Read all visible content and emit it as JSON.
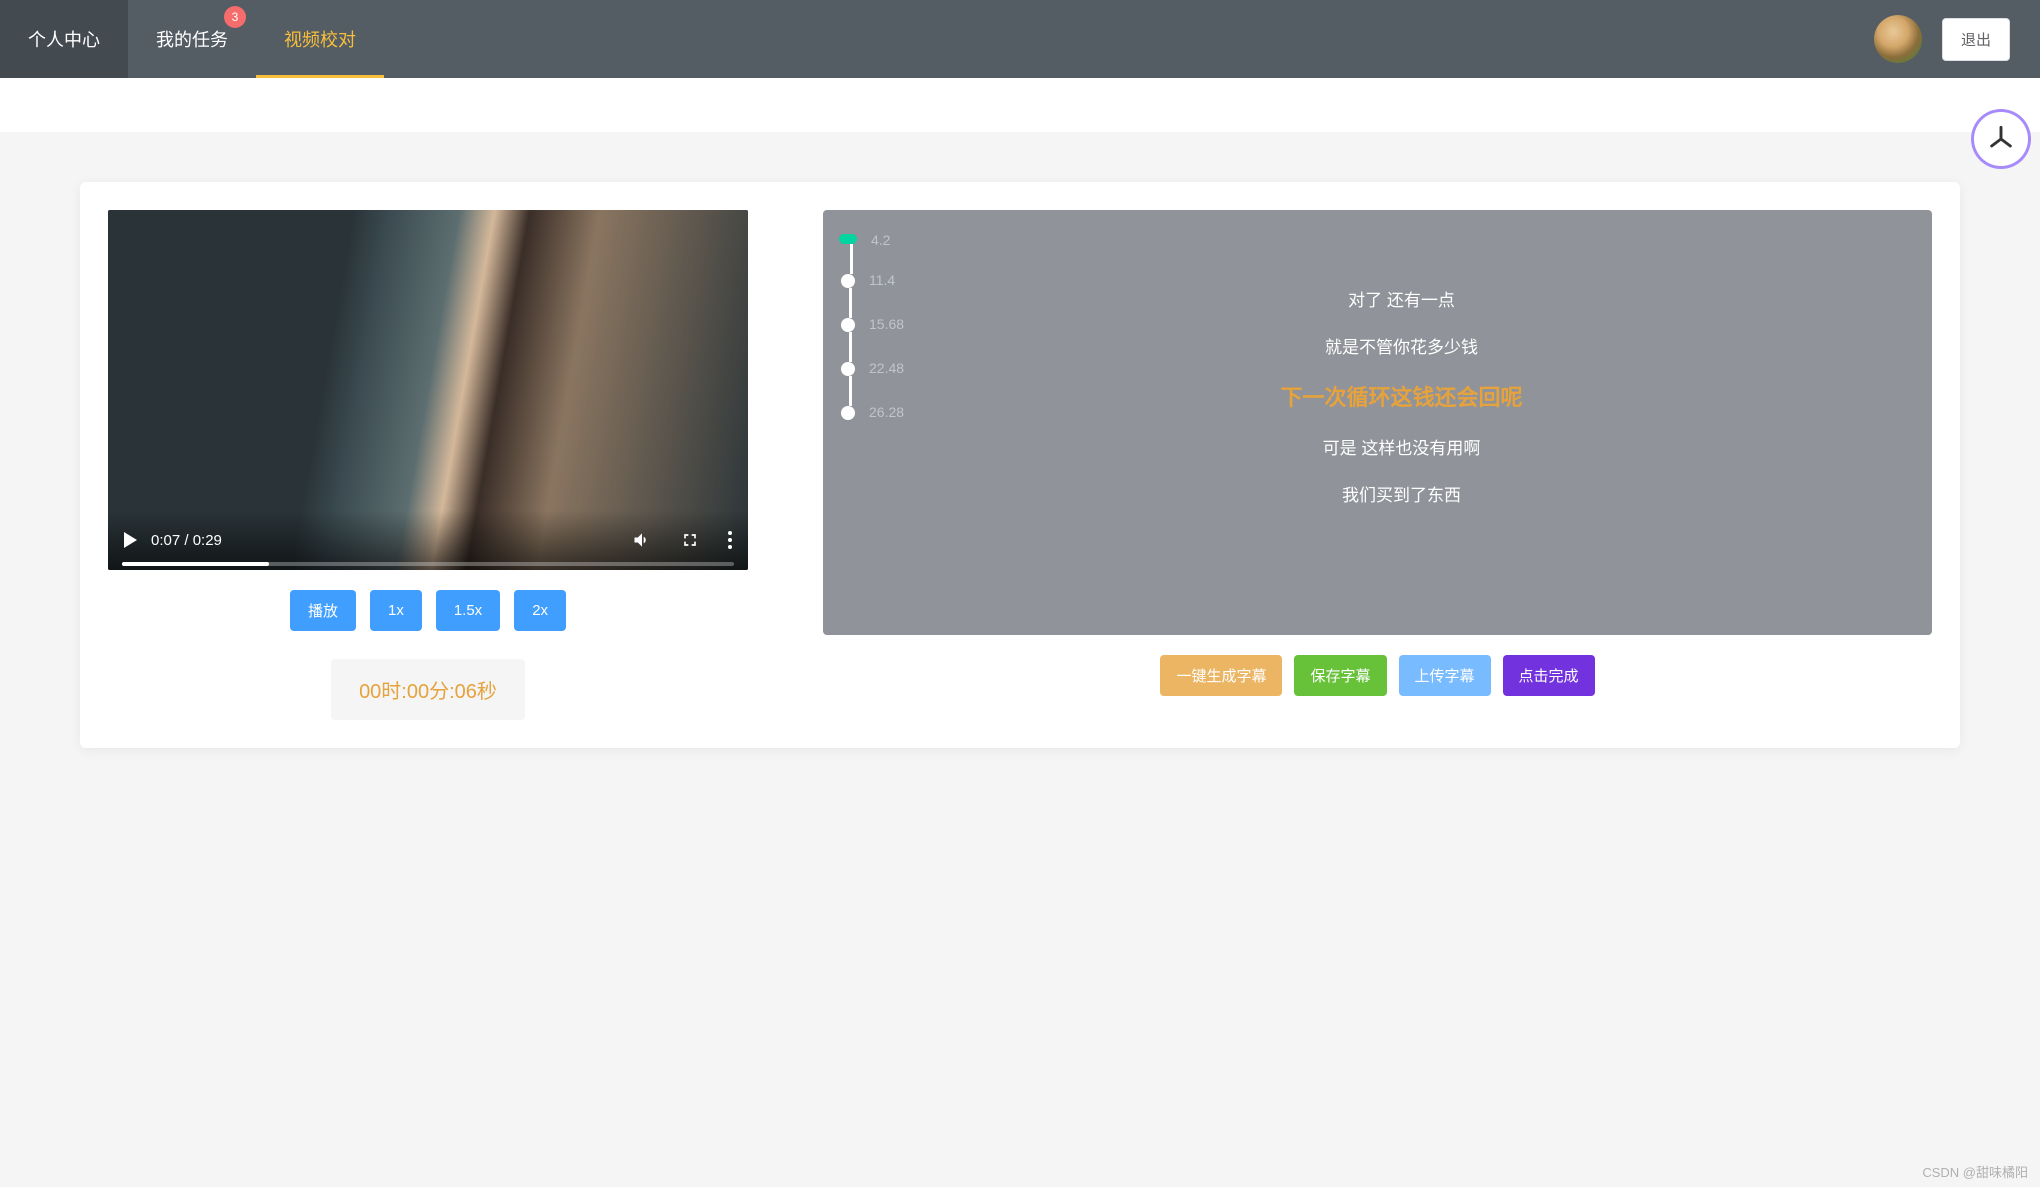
{
  "header": {
    "tabs": [
      {
        "label": "个人中心",
        "active": false
      },
      {
        "label": "我的任务",
        "active": false,
        "badge": "3"
      },
      {
        "label": "视频校对",
        "active": true
      }
    ],
    "logout": "退出"
  },
  "video": {
    "current_time": "0:07",
    "duration": "0:29",
    "time_display": "0:07 / 0:29"
  },
  "speed_buttons": {
    "play": "播放",
    "x1": "1x",
    "x15": "1.5x",
    "x2": "2x"
  },
  "timer": "00时:00分:06秒",
  "timeline_markers": [
    {
      "time": "4.2",
      "active": true
    },
    {
      "time": "11.4",
      "active": false
    },
    {
      "time": "15.68",
      "active": false
    },
    {
      "time": "22.48",
      "active": false
    },
    {
      "time": "26.28",
      "active": false
    }
  ],
  "subtitles": [
    {
      "text": "对了 还有一点",
      "active": false
    },
    {
      "text": "就是不管你花多少钱",
      "active": false
    },
    {
      "text": "下一次循环这钱还会回呢",
      "active": true
    },
    {
      "text": "可是 这样也没有用啊",
      "active": false
    },
    {
      "text": "我们买到了东西",
      "active": false
    }
  ],
  "actions": {
    "generate": "一键生成字幕",
    "save": "保存字幕",
    "upload": "上传字幕",
    "complete": "点击完成"
  },
  "watermark": "CSDN @甜味橘阳"
}
